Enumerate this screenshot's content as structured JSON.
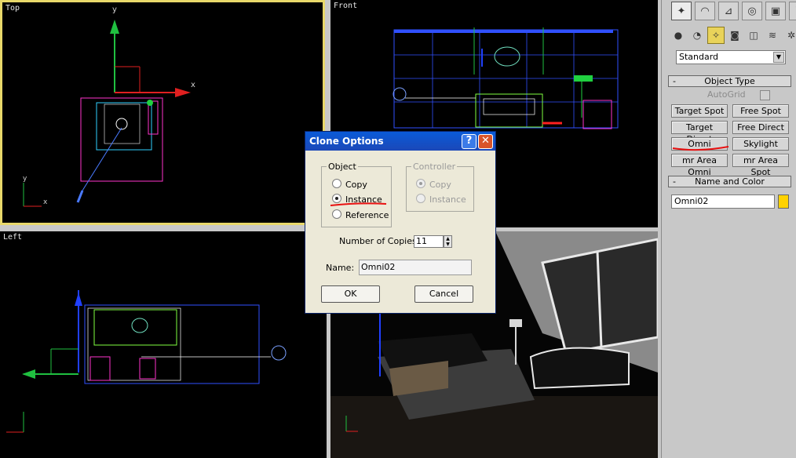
{
  "viewports": {
    "top": "Top",
    "front": "Front",
    "left": "Left",
    "axis_x": "x",
    "axis_y": "y"
  },
  "panel": {
    "tabs": [
      "create-tab",
      "modify-tab",
      "hierarchy-tab",
      "motion-tab",
      "display-tab",
      "utilities-tab"
    ],
    "category_icons": [
      "geometry",
      "shapes",
      "lights",
      "cameras",
      "helpers",
      "space-warps",
      "systems"
    ],
    "dropdown_value": "Standard",
    "object_type_title": "Object Type",
    "autogrid_label": "AutoGrid",
    "buttons": {
      "target_spot": "Target Spot",
      "free_spot": "Free Spot",
      "target_direct": "Target Direct",
      "free_direct": "Free Direct",
      "omni": "Omni",
      "skylight": "Skylight",
      "mr_area_omni": "mr Area Omni",
      "mr_area_spot": "mr Area Spot"
    },
    "name_color_title": "Name and Color",
    "name_value": "Omni02",
    "swatch_color": "#ffd200",
    "collapse_symbol": "-"
  },
  "dialog": {
    "title": "Clone Options",
    "help_symbol": "?",
    "close_symbol": "✕",
    "object_legend": "Object",
    "object_options": [
      "Copy",
      "Instance",
      "Reference"
    ],
    "object_selected": "Instance",
    "controller_legend": "Controller",
    "controller_options": [
      "Copy",
      "Instance"
    ],
    "controller_selected": "Copy",
    "copies_label": "Number of Copies:",
    "copies_value": "11",
    "name_label": "Name:",
    "name_value": "Omni02",
    "ok_label": "OK",
    "cancel_label": "Cancel"
  },
  "colors": {
    "annotation": "#e81010",
    "active_viewport_border": "#e8d86a",
    "dialog_title": "#0a5bd8"
  }
}
